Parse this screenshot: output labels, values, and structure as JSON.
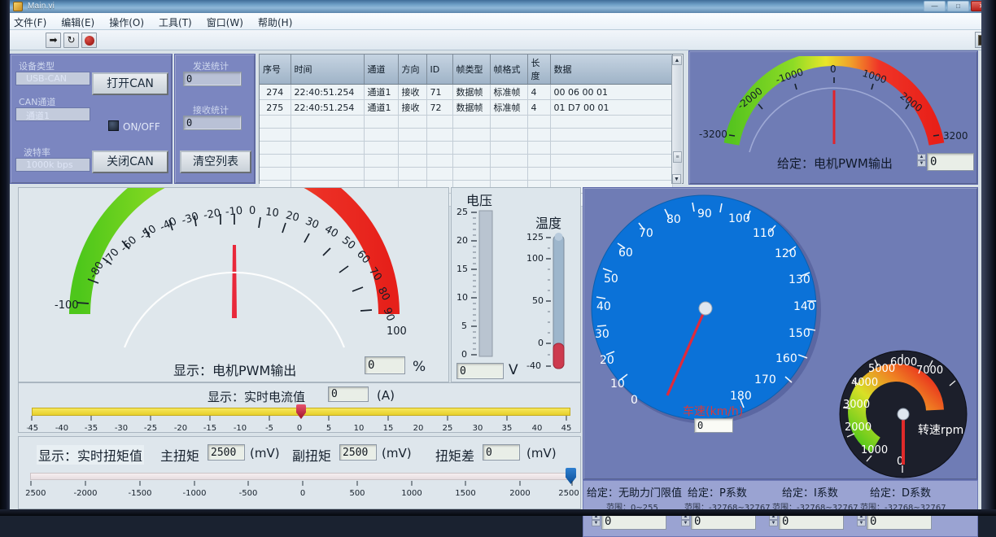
{
  "window": {
    "title": "Main.vi",
    "icon": "labview-vi-icon",
    "buttons": {
      "minimize": "—",
      "maximize": "□",
      "close": "✕"
    }
  },
  "menu": [
    "文件(F)",
    "编辑(E)",
    "操作(O)",
    "工具(T)",
    "窗口(W)",
    "帮助(H)"
  ],
  "toolbar": {
    "run": "➡",
    "run_continuous": "↻",
    "abort": "abort-dot",
    "app_icon": "vi-thumbnail-icon"
  },
  "can_panel": {
    "device_type_label": "设备类型",
    "device_type_value": "USB-CAN",
    "channel_label": "CAN通道",
    "channel_value": "通道1",
    "baud_label": "波特率",
    "baud_value": "1000k bps",
    "open_button": "打开CAN",
    "close_button": "关闭CAN",
    "onoff_label": "ON/OFF",
    "send_count_label": "发送统计",
    "send_count_value": "0",
    "recv_count_label": "接收统计",
    "recv_count_value": "0",
    "clear_button": "清空列表"
  },
  "message_table": {
    "headers": [
      "序号",
      "时间",
      "通道",
      "方向",
      "ID",
      "帧类型",
      "帧格式",
      "长度",
      "数据"
    ],
    "rows": [
      [
        "274",
        "22:40:51.254",
        "通道1",
        "接收",
        "71",
        "数据帧",
        "标准帧",
        "4",
        "00 06 00 01"
      ],
      [
        "275",
        "22:40:51.254",
        "通道1",
        "接收",
        "72",
        "数据帧",
        "标准帧",
        "4",
        "01 D7 00 01"
      ]
    ],
    "empty_rows": 7,
    "scroll_up": "▲",
    "scroll_down": "▼"
  },
  "pwm_set_gauge": {
    "label": "给定：电机PWM输出",
    "value": "0",
    "min": -3200,
    "max": 3200,
    "ticks": [
      -3200,
      -2000,
      -1000,
      0,
      1000,
      2000,
      3200
    ],
    "needle_value": 0
  },
  "pwm_show_gauge": {
    "label": "显示：电机PWM输出",
    "value": "0",
    "unit": "%",
    "min": -100,
    "max": 100,
    "ticks": [
      -100,
      -80,
      -70,
      -60,
      -50,
      -40,
      -30,
      -20,
      -10,
      0,
      10,
      20,
      30,
      40,
      50,
      60,
      70,
      80,
      90,
      100
    ],
    "needle_value": 0
  },
  "voltage_meter": {
    "title": "电压",
    "value": "0",
    "unit": "V",
    "min": 0,
    "max": 25,
    "ticks": [
      0,
      5,
      10,
      15,
      20,
      25
    ],
    "fill_value": 0
  },
  "temperature_meter": {
    "title": "温度",
    "value": "0",
    "min": -40,
    "max": 125,
    "ticks": [
      -40,
      0,
      50,
      100,
      125
    ],
    "fill_value": 0
  },
  "speed_gauge": {
    "label": "车速(km/h)",
    "value": "0",
    "min": 0,
    "max": 180,
    "ticks": [
      0,
      10,
      20,
      30,
      40,
      50,
      60,
      70,
      80,
      90,
      100,
      110,
      120,
      130,
      140,
      150,
      160,
      170,
      180
    ],
    "needle_value": 0,
    "face_color": "#0b72d8"
  },
  "rpm_gauge": {
    "label": "转速rpm",
    "min": 0,
    "max": 7000,
    "ticks": [
      0,
      1000,
      2000,
      3000,
      4000,
      5000,
      6000,
      7000
    ],
    "needle_value": 0,
    "face_color": "#1c1f2b"
  },
  "current_slider": {
    "label": "显示：实时电流值",
    "value": "0",
    "unit": "(A)",
    "min": -45,
    "max": 45,
    "ticks": [
      -45,
      -40,
      -35,
      -30,
      -25,
      -20,
      -15,
      -10,
      -5,
      0,
      5,
      10,
      15,
      20,
      25,
      30,
      35,
      40,
      45
    ],
    "thumb_value": 0,
    "bar_color": "#f2dd3c"
  },
  "torque_slider": {
    "label": "显示：实时扭矩值",
    "main_label": "主扭矩",
    "main_value": "2500",
    "main_unit": "(mV)",
    "sub_label": "副扭矩",
    "sub_value": "2500",
    "sub_unit": "(mV)",
    "diff_label": "扭矩差",
    "diff_value": "0",
    "diff_unit": "(mV)",
    "min": -2500,
    "max": 2500,
    "ticks": [
      -2500,
      -2000,
      -1500,
      -1000,
      -500,
      0,
      500,
      1000,
      1500,
      2000,
      2500
    ],
    "thumb_value": 2500
  },
  "pid_controls": [
    {
      "title": "给定：无助力门限值",
      "range": "范围：0~255",
      "value": "0"
    },
    {
      "title": "给定：P系数",
      "range": "范围：-32768~32767",
      "value": "0"
    },
    {
      "title": "给定：I系数",
      "range": "范围：-32768~32767",
      "value": "0"
    },
    {
      "title": "给定：D系数",
      "range": "范围：-32768~32767",
      "value": "0"
    }
  ]
}
